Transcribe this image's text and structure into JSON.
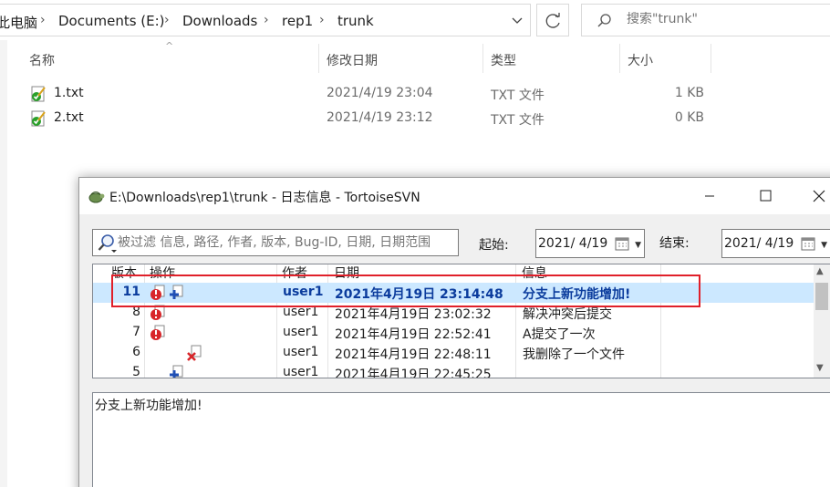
{
  "explorer": {
    "breadcrumbs": [
      "此电脑",
      "Documents (E:)",
      "Downloads",
      "rep1",
      "trunk"
    ],
    "search_placeholder": "搜索\"trunk\"",
    "columns": {
      "name": "名称",
      "date": "修改日期",
      "type": "类型",
      "size": "大小"
    },
    "files": [
      {
        "name": "1.txt",
        "date": "2021/4/19 23:04",
        "type": "TXT 文件",
        "size": "1 KB"
      },
      {
        "name": "2.txt",
        "date": "2021/4/19 23:12",
        "type": "TXT 文件",
        "size": "0 KB"
      }
    ]
  },
  "svn": {
    "title": "E:\\Downloads\\rep1\\trunk - 日志信息 - TortoiseSVN",
    "filter_placeholder": "被过滤 信息, 路径, 作者, 版本, Bug-ID, 日期, 日期范围",
    "from_label": "起始:",
    "from_date": "2021/  4/19",
    "to_label": "结束:",
    "to_date": "2021/  4/19",
    "list_columns": {
      "rev": "版本",
      "actions": "操作",
      "author": "作者",
      "date": "日期",
      "message": "信息"
    },
    "rows": [
      {
        "rev": "11",
        "actions": [
          "modified-icon",
          "added-icon"
        ],
        "author": "user1",
        "date": "2021年4月19日 23:14:48",
        "message": "分支上新功能增加!",
        "selected": true
      },
      {
        "rev": "8",
        "actions": [
          "modified-icon"
        ],
        "author": "user1",
        "date": "2021年4月19日 23:02:32",
        "message": "解决冲突后提交"
      },
      {
        "rev": "7",
        "actions": [
          "modified-icon"
        ],
        "author": "user1",
        "date": "2021年4月19日 22:52:41",
        "message": "A提交了一次"
      },
      {
        "rev": "6",
        "actions": [
          "deleted-icon"
        ],
        "author": "user1",
        "date": "2021年4月19日 22:48:11",
        "message": "我删除了一个文件"
      },
      {
        "rev": "5",
        "actions": [
          "added-icon"
        ],
        "author": "user1",
        "date": "2021年4月19日 22:45:25",
        "message": ""
      }
    ],
    "log_message": "分支上新功能增加!"
  },
  "colors": {
    "selection": "#cce8ff",
    "selected_text": "#0b3c9d",
    "highlight_box": "#e0202a"
  }
}
